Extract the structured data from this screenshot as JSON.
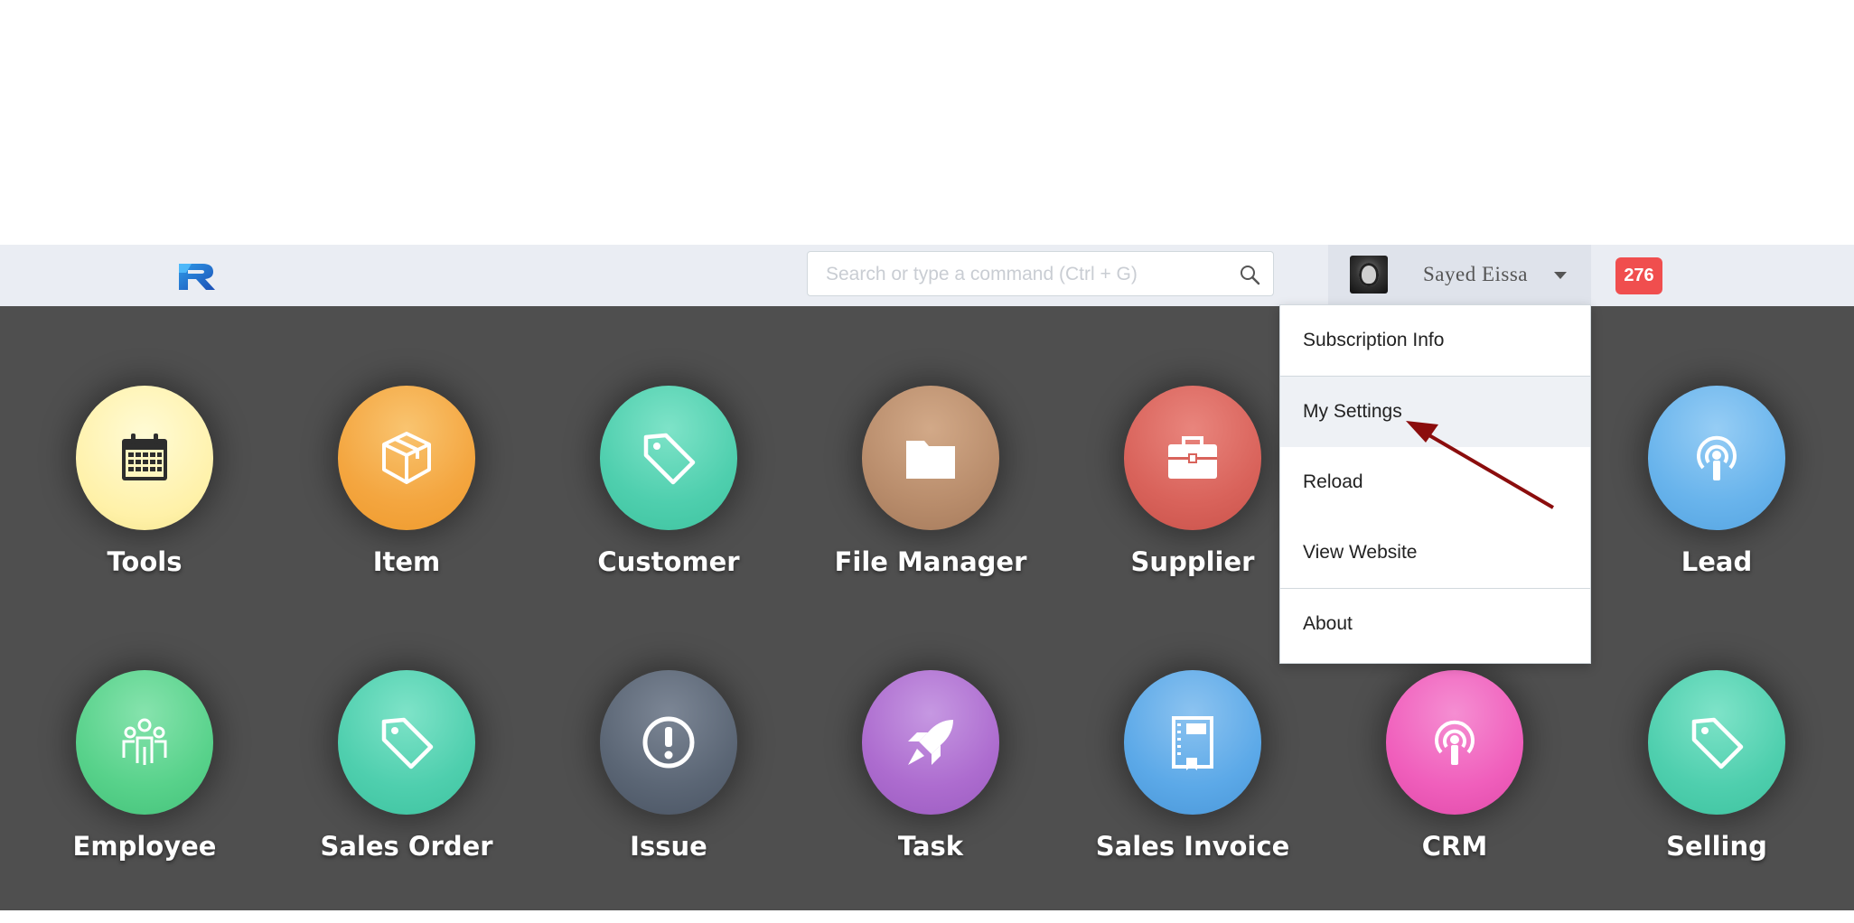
{
  "navbar": {
    "logo_name": "R-logo",
    "search": {
      "placeholder": "Search or type a command (Ctrl + G)",
      "value": ""
    },
    "user": {
      "name": "Sayed Eissa"
    },
    "notification_count": "276"
  },
  "user_menu": {
    "items": [
      {
        "label": "Subscription Info"
      },
      {
        "label": "My Settings",
        "highlighted": true
      },
      {
        "label": "Reload"
      },
      {
        "label": "View Website"
      },
      {
        "label": "About"
      }
    ]
  },
  "desktop": {
    "row1": [
      {
        "label": "Tools",
        "icon": "calendar-icon",
        "color": "#fff3b8"
      },
      {
        "label": "Item",
        "icon": "box-icon",
        "color": "#f4a640"
      },
      {
        "label": "Customer",
        "icon": "tag-icon",
        "color": "#4fcfae"
      },
      {
        "label": "File Manager",
        "icon": "folder-icon",
        "color": "#b98d6c"
      },
      {
        "label": "Supplier",
        "icon": "briefcase-icon",
        "color": "#d9635b"
      },
      {
        "label": "Lead",
        "icon": "broadcast-icon",
        "color": "#69b4ec"
      }
    ],
    "row2": [
      {
        "label": "Employee",
        "icon": "group-icon",
        "color": "#58d28b"
      },
      {
        "label": "Sales Order",
        "icon": "tag-icon",
        "color": "#4fcfae"
      },
      {
        "label": "Issue",
        "icon": "exclamation-icon",
        "color": "#5b6675"
      },
      {
        "label": "Task",
        "icon": "rocket-icon",
        "color": "#ad6ccf"
      },
      {
        "label": "Sales Invoice",
        "icon": "book-icon",
        "color": "#5ca9e8"
      },
      {
        "label": "CRM",
        "icon": "broadcast-icon",
        "color": "#f05fbc"
      },
      {
        "label": "Selling",
        "icon": "tag-icon",
        "color": "#4fcfae"
      }
    ]
  },
  "annotation_color": "#8b0d0d"
}
